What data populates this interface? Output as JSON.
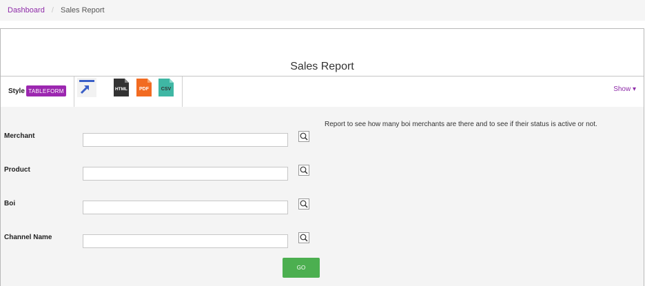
{
  "breadcrumb": {
    "home": "Dashboard",
    "separator": "/",
    "current": "Sales Report"
  },
  "report": {
    "title": "Sales Report",
    "description": "Report to see how many boi merchants are there and to see if their status is active or not."
  },
  "toolbar": {
    "style_label": "Style",
    "style_options": [
      "TABLE",
      "FORM"
    ],
    "export_icons": [
      "open-new-window-icon",
      "html-file-icon",
      "pdf-file-icon",
      "csv-file-icon"
    ],
    "html_label": "HTML",
    "pdf_label": "PDF",
    "csv_label": "CSV",
    "show_label": "Show ▾"
  },
  "fields": [
    {
      "label": "Merchant",
      "value": "",
      "placeholder": ""
    },
    {
      "label": "Product",
      "value": "",
      "placeholder": ""
    },
    {
      "label": "Boi",
      "value": "",
      "placeholder": ""
    },
    {
      "label": "Channel Name",
      "value": "",
      "placeholder": ""
    }
  ],
  "go_label": "GO",
  "colors": {
    "accent": "#9c27b0",
    "link": "#8e2ba8",
    "go": "#4caf50",
    "pdf": "#f26b21",
    "csv": "#3fb7a4",
    "html": "#333333"
  }
}
